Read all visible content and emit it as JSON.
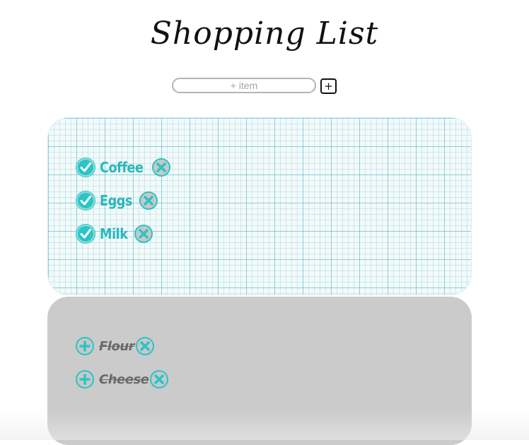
{
  "header": {
    "title": "Shopping List"
  },
  "add_form": {
    "placeholder": "+ item",
    "add_button_label": "+"
  },
  "active_items": [
    {
      "label": "Coffee"
    },
    {
      "label": "Eggs"
    },
    {
      "label": "Milk"
    }
  ],
  "completed_items": [
    {
      "label": "Flour"
    },
    {
      "label": "Cheese"
    }
  ],
  "colors": {
    "accent": "#2cc4c4",
    "completed_panel": "#cbcbcb",
    "completed_text": "#6a6a6a"
  },
  "icons": {
    "check": "check-icon",
    "remove": "x-icon",
    "restore": "plus-icon"
  }
}
